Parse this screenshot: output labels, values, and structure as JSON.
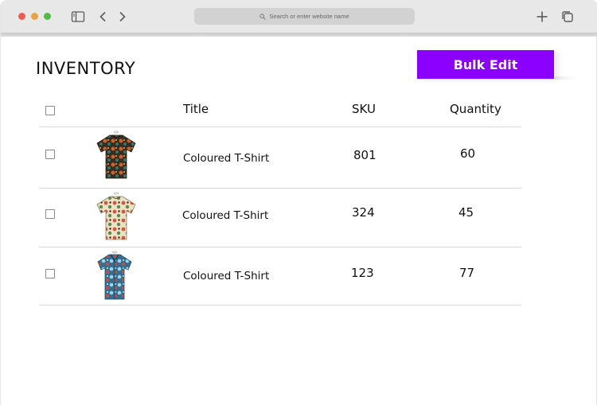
{
  "browser": {
    "address_placeholder": "Search or enter website name"
  },
  "page": {
    "title": "INVENTORY",
    "bulk_edit_label": "Bulk Edit"
  },
  "table": {
    "headers": {
      "title": "Title",
      "sku": "SKU",
      "quantity": "Quantity"
    },
    "rows": [
      {
        "title": "Coloured T-Shirt",
        "sku": "801",
        "quantity": "60",
        "image": "tshirt-dark-floral"
      },
      {
        "title": "Coloured T-Shirt",
        "sku": "324",
        "quantity": "45",
        "image": "tshirt-cream-floral"
      },
      {
        "title": "Coloured T-Shirt",
        "sku": "123",
        "quantity": "77",
        "image": "shirt-blue-floral"
      }
    ]
  },
  "colors": {
    "accent": "#8b00ff"
  }
}
